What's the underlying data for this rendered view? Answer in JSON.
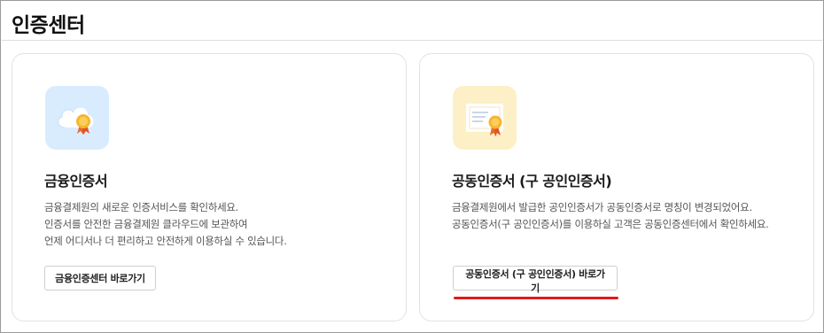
{
  "page": {
    "title": "인증센터"
  },
  "cards": [
    {
      "icon": "cloud-certificate-icon",
      "title": "금융인증서",
      "description": [
        "금융결제원의 새로운 인증서비스를 확인하세요.",
        "인증서를 안전한 금융결제원 클라우드에 보관하여",
        "언제 어디서나 더 편리하고 안전하게 이용하실 수 있습니다."
      ],
      "button_label": "금융인증센터 바로가기"
    },
    {
      "icon": "document-certificate-icon",
      "title": "공동인증서 (구 공인인증서)",
      "description": [
        "금융결제원에서 발급한 공인인증서가 공동인증서로 명칭이 변경되었어요.",
        "공동인증서(구 공인인증서)를 이용하실 고객은 공동인증센터에서 확인하세요."
      ],
      "button_label": "공동인증서 (구 공인인증서) 바로가기"
    }
  ],
  "colors": {
    "highlight_underline": "#e0191b",
    "blue_tile": "#d9ecfd",
    "yellow_tile": "#fdefc6"
  }
}
